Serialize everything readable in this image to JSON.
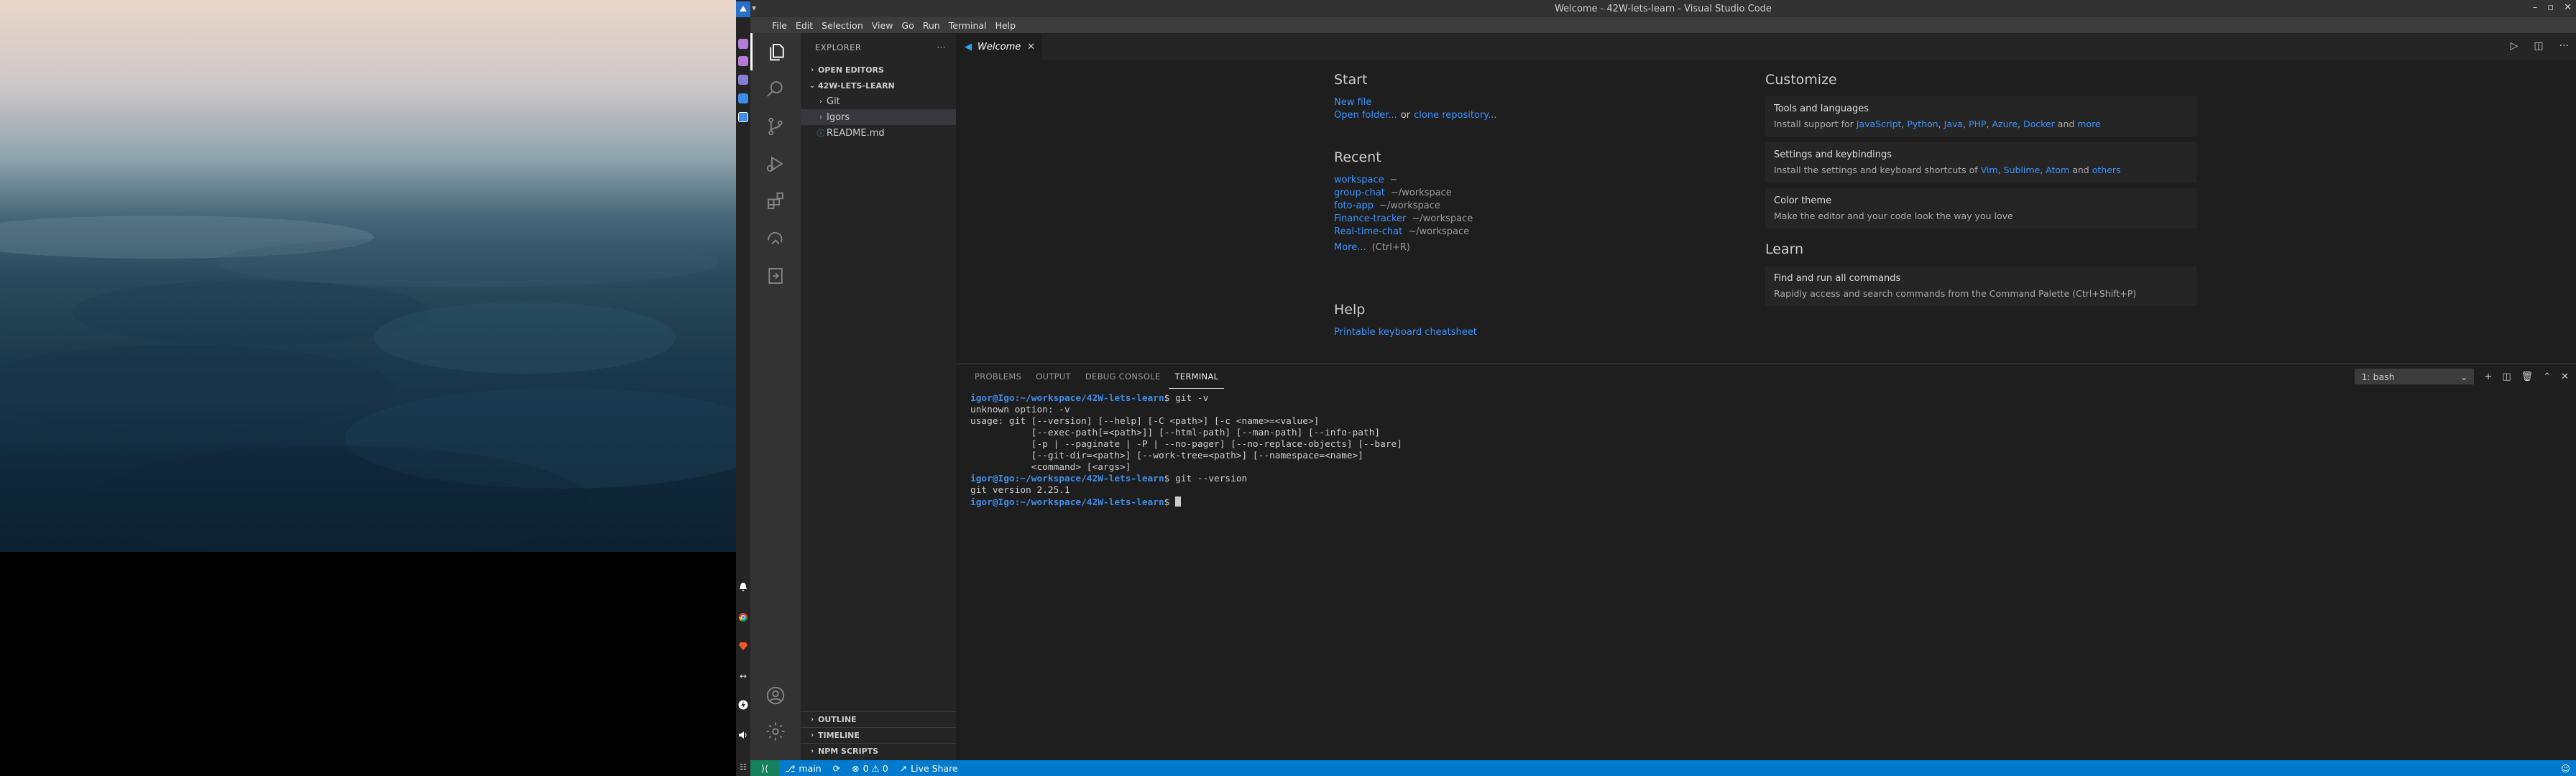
{
  "window": {
    "title": "Welcome - 42W-lets-learn - Visual Studio Code"
  },
  "menubar": {
    "items": [
      "File",
      "Edit",
      "Selection",
      "View",
      "Go",
      "Run",
      "Terminal",
      "Help"
    ]
  },
  "explorer": {
    "header": "EXPLORER",
    "open_editors": "OPEN EDITORS",
    "workspace": "42W-LETS-LEARN",
    "items": [
      {
        "label": "Git",
        "type": "folder"
      },
      {
        "label": "Igors",
        "type": "folder"
      },
      {
        "label": "README.md",
        "type": "file"
      }
    ],
    "outline": "OUTLINE",
    "timeline": "TIMELINE",
    "npm_scripts": "NPM SCRIPTS"
  },
  "tab": {
    "label": "Welcome"
  },
  "welcome": {
    "start": {
      "heading": "Start",
      "new_file": "New file",
      "open_folder": "Open folder...",
      "or": "or",
      "clone": "clone repository..."
    },
    "recent": {
      "heading": "Recent",
      "items": [
        {
          "name": "workspace",
          "path": "~"
        },
        {
          "name": "group-chat",
          "path": "~/workspace"
        },
        {
          "name": "foto-app",
          "path": "~/workspace"
        },
        {
          "name": "Finance-tracker",
          "path": "~/workspace"
        },
        {
          "name": "Real-time-chat",
          "path": "~/workspace"
        }
      ],
      "more": "More...",
      "more_shortcut": "(Ctrl+R)"
    },
    "help": {
      "heading": "Help",
      "link1": "Printable keyboard cheatsheet"
    },
    "customize": {
      "heading": "Customize",
      "tools_title": "Tools and languages",
      "tools_desc_prefix": "Install support for",
      "tools_langs": [
        "JavaScript",
        "Python",
        "Java",
        "PHP",
        "Azure",
        "Docker"
      ],
      "tools_and": "and",
      "tools_more": "more",
      "settings_title": "Settings and keybindings",
      "settings_desc_prefix": "Install the settings and keyboard shortcuts of",
      "settings_vim": "Vim",
      "settings_sublime": "Sublime",
      "settings_atom": "Atom",
      "settings_and": "and",
      "settings_others": "others",
      "theme_title": "Color theme",
      "theme_desc": "Make the editor and your code look the way you love"
    },
    "learn": {
      "heading": "Learn",
      "find_title": "Find and run all commands",
      "find_desc": "Rapidly access and search commands from the Command Palette (Ctrl+Shift+P)"
    }
  },
  "panel": {
    "tabs": [
      "PROBLEMS",
      "OUTPUT",
      "DEBUG CONSOLE",
      "TERMINAL"
    ],
    "active_tab": "TERMINAL",
    "terminal_select": "1: bash"
  },
  "terminal": {
    "prompt_user": "igor@Igo",
    "prompt_path": ":~/workspace/42W-lets-learn",
    "lines": [
      {
        "type": "prompt",
        "cmd": " git -v"
      },
      {
        "type": "out",
        "text": "unknown option: -v"
      },
      {
        "type": "out",
        "text": "usage: git [--version] [--help] [-C <path>] [-c <name>=<value>]"
      },
      {
        "type": "out",
        "text": "           [--exec-path[=<path>]] [--html-path] [--man-path] [--info-path]"
      },
      {
        "type": "out",
        "text": "           [-p | --paginate | -P | --no-pager] [--no-replace-objects] [--bare]"
      },
      {
        "type": "out",
        "text": "           [--git-dir=<path>] [--work-tree=<path>] [--namespace=<name>]"
      },
      {
        "type": "out",
        "text": "           <command> [<args>]"
      },
      {
        "type": "prompt",
        "cmd": " git --version"
      },
      {
        "type": "out",
        "text": "git version 2.25.1"
      },
      {
        "type": "prompt",
        "cmd": " ",
        "cursor": true
      }
    ]
  },
  "statusbar": {
    "branch": "main",
    "problems": "0 ⚠ 0",
    "errors": "0",
    "warnings": "0",
    "live_share": "Live Share"
  }
}
